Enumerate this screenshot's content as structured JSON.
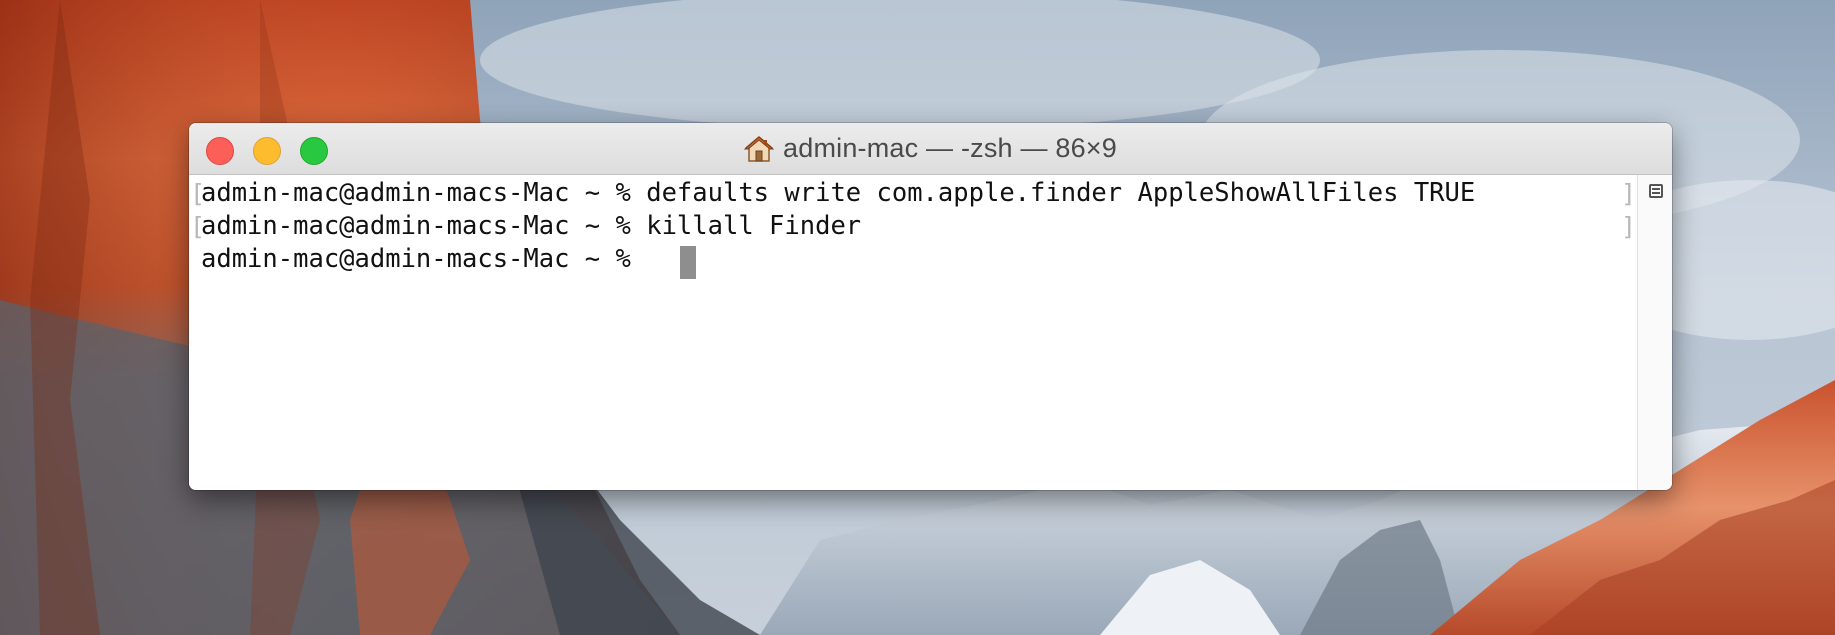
{
  "window": {
    "title": "admin-mac — -zsh — 86×9",
    "title_icon": "home-icon"
  },
  "terminal": {
    "lines": [
      "admin-mac@admin-macs-Mac ~ % defaults write com.apple.finder AppleShowAllFiles TRUE",
      "admin-mac@admin-macs-Mac ~ % killall Finder",
      "admin-mac@admin-macs-Mac ~ % "
    ],
    "prompt_marks": {
      "open": "[",
      "close": "]"
    }
  },
  "colors": {
    "close": "#fc5f57",
    "minimize": "#fdbc2e",
    "zoom": "#28c840",
    "cursor": "#8e8e8e"
  },
  "icons": {
    "split_view": "split-pane-icon"
  }
}
